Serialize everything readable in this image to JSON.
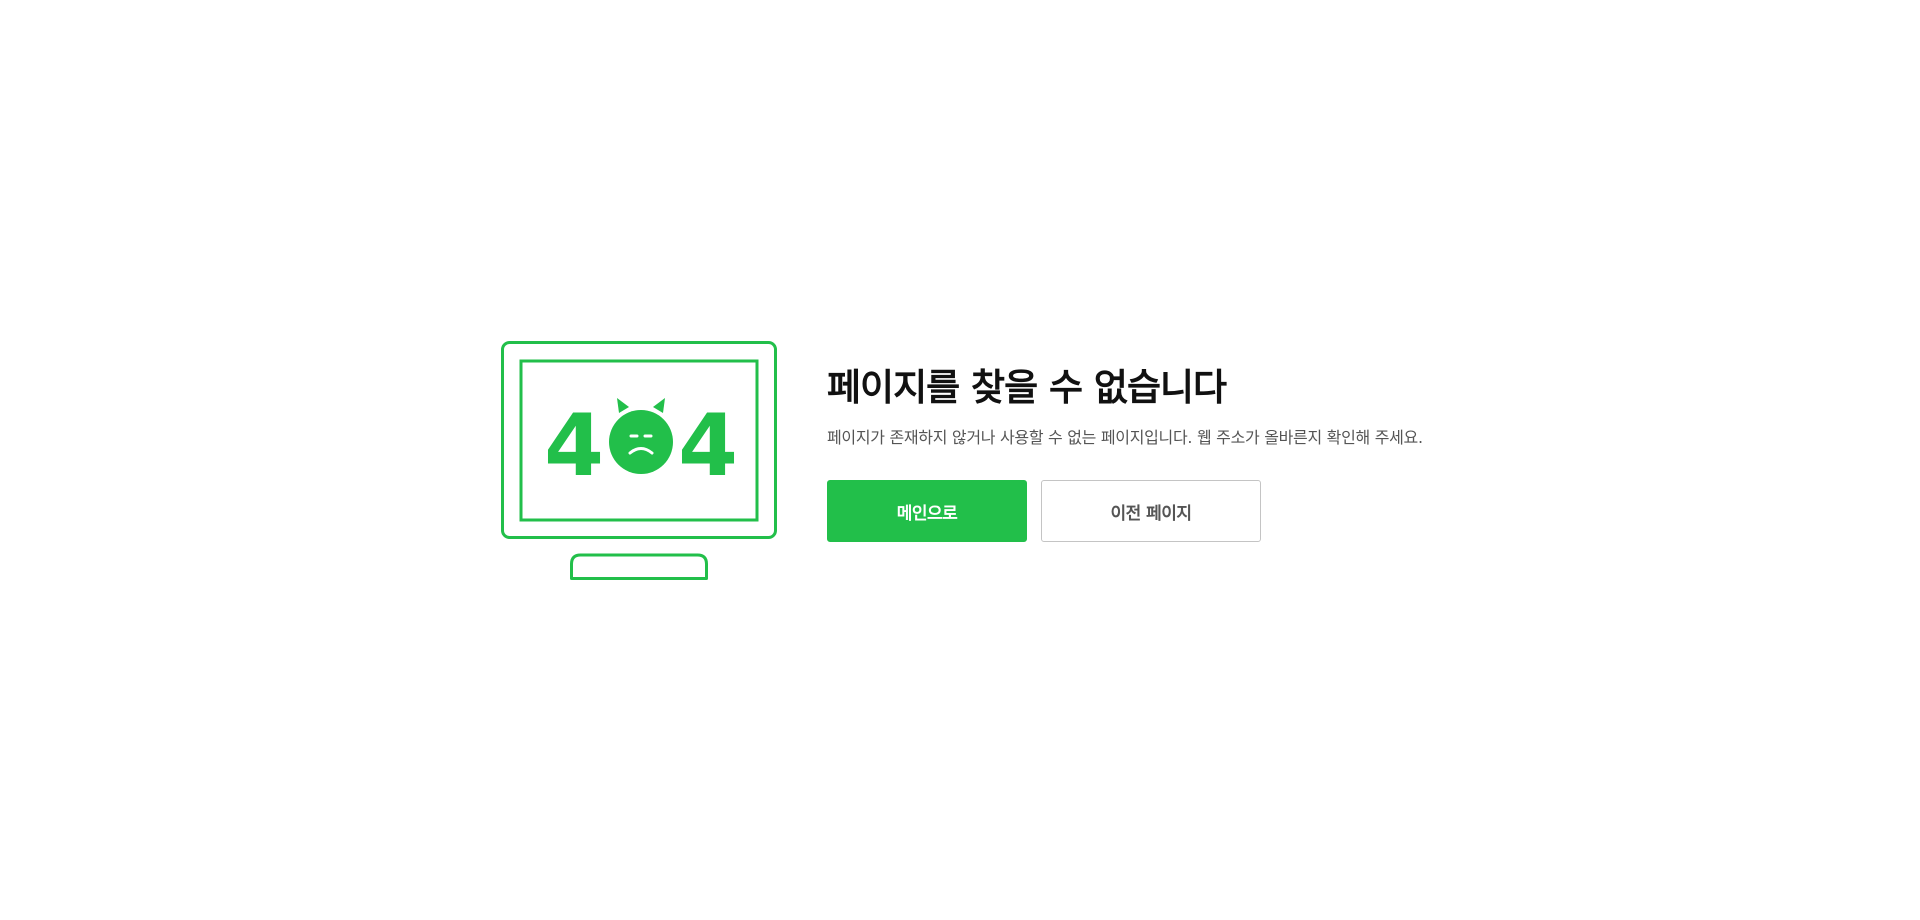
{
  "error": {
    "title": "페이지를 찾을 수 없습니다",
    "description": "페이지가 존재하지 않거나 사용할 수 없는 페이지입니다. 웹 주소가 올바른지 확인해 주세요.",
    "code_left": "4",
    "code_right": "4"
  },
  "buttons": {
    "main_label": "메인으로",
    "back_label": "이전 페이지"
  },
  "colors": {
    "accent": "#22bf4a",
    "title": "#111111",
    "text": "#555555",
    "border": "#c4c4c4",
    "background": "#ffffff"
  },
  "icons": {
    "illustration": "monitor-404-illustration",
    "mascot": "sad-cat-face-icon"
  }
}
